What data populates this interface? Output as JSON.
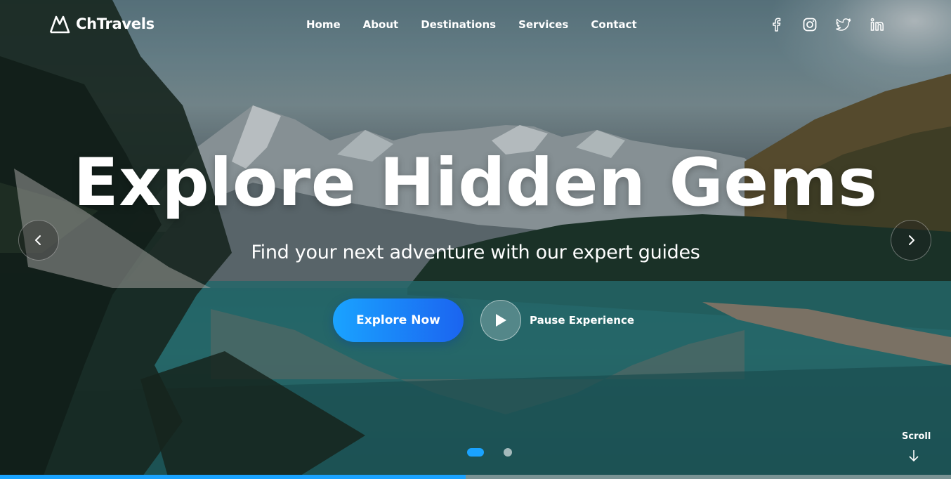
{
  "brand": {
    "name": "ChTravels"
  },
  "nav": {
    "items": [
      {
        "label": "Home"
      },
      {
        "label": "About"
      },
      {
        "label": "Destinations"
      },
      {
        "label": "Services"
      },
      {
        "label": "Contact"
      }
    ]
  },
  "social": [
    {
      "icon": "facebook-icon"
    },
    {
      "icon": "instagram-icon"
    },
    {
      "icon": "twitter-icon"
    },
    {
      "icon": "linkedin-icon"
    }
  ],
  "hero": {
    "headline": "Explore Hidden Gems",
    "subtitle": "Find your next adventure with our expert guides",
    "cta_label": "Explore Now",
    "play_label": "Pause Experience"
  },
  "slider": {
    "slide_count": 2,
    "active_index": 0
  },
  "scroll": {
    "label": "Scroll"
  },
  "progress": {
    "fraction": 0.49
  },
  "colors": {
    "accent": "#1aa3ff",
    "accent_dark": "#1b64f0",
    "text": "#ffffff"
  }
}
